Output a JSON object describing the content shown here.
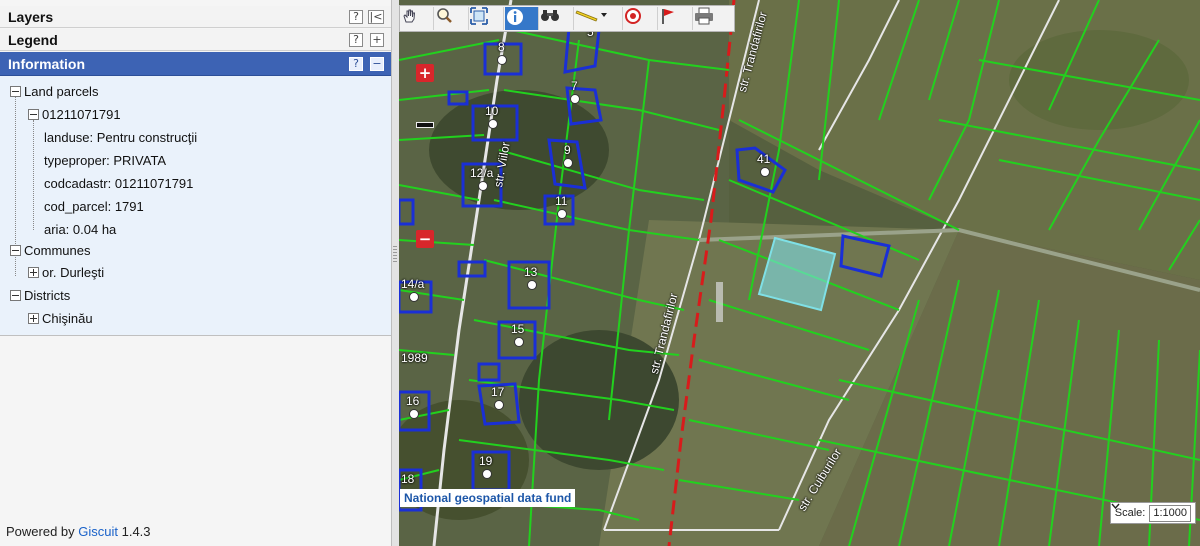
{
  "panels": {
    "layers": {
      "title": "Layers"
    },
    "legend": {
      "title": "Legend"
    },
    "information": {
      "title": "Information"
    }
  },
  "tree": {
    "land_parcels": "Land parcels",
    "parcel_id": "01211071791",
    "attributes": [
      "landuse: Pentru construcţii",
      "typeproper: PRIVATA",
      "codcadastr: 01211071791",
      "cod_parcel: 1791",
      "aria: 0.04 ha"
    ],
    "communes": "Communes",
    "commune_item": "or. Durleşti",
    "districts": "Districts",
    "district_item": "Chişinău"
  },
  "footer": {
    "prefix": "Powered by ",
    "link": "Giscuit",
    "version": " 1.4.3"
  },
  "toolbar": {
    "tools": [
      "pan-hand-icon",
      "zoom-in-magnifier-icon",
      "zoom-extent-icon",
      "info-icon",
      "binoculars-icon",
      "measure-ruler-icon",
      "target-icon",
      "flag-icon",
      "print-icon"
    ]
  },
  "map": {
    "attribution": "National geospatial data fund",
    "scale_label": "Scale:",
    "scale_value": "1:1000",
    "parcel_labels": [
      "8",
      "5",
      "7",
      "10",
      "9",
      "41",
      "12/a",
      "11",
      "13",
      "14/a",
      "15",
      "16",
      "17",
      "18",
      "19"
    ],
    "edge_label": "1989",
    "streets": [
      "str. Viilor",
      "str. Trandafirilor",
      "str. Trandafirilor",
      "str. Cuiburilor"
    ],
    "colors": {
      "parcel_lines": "#22d11e",
      "building_outline": "#1a2fd6",
      "selected_parcel": "#7fe0e6",
      "district_boundary": "#d81b1b"
    }
  }
}
